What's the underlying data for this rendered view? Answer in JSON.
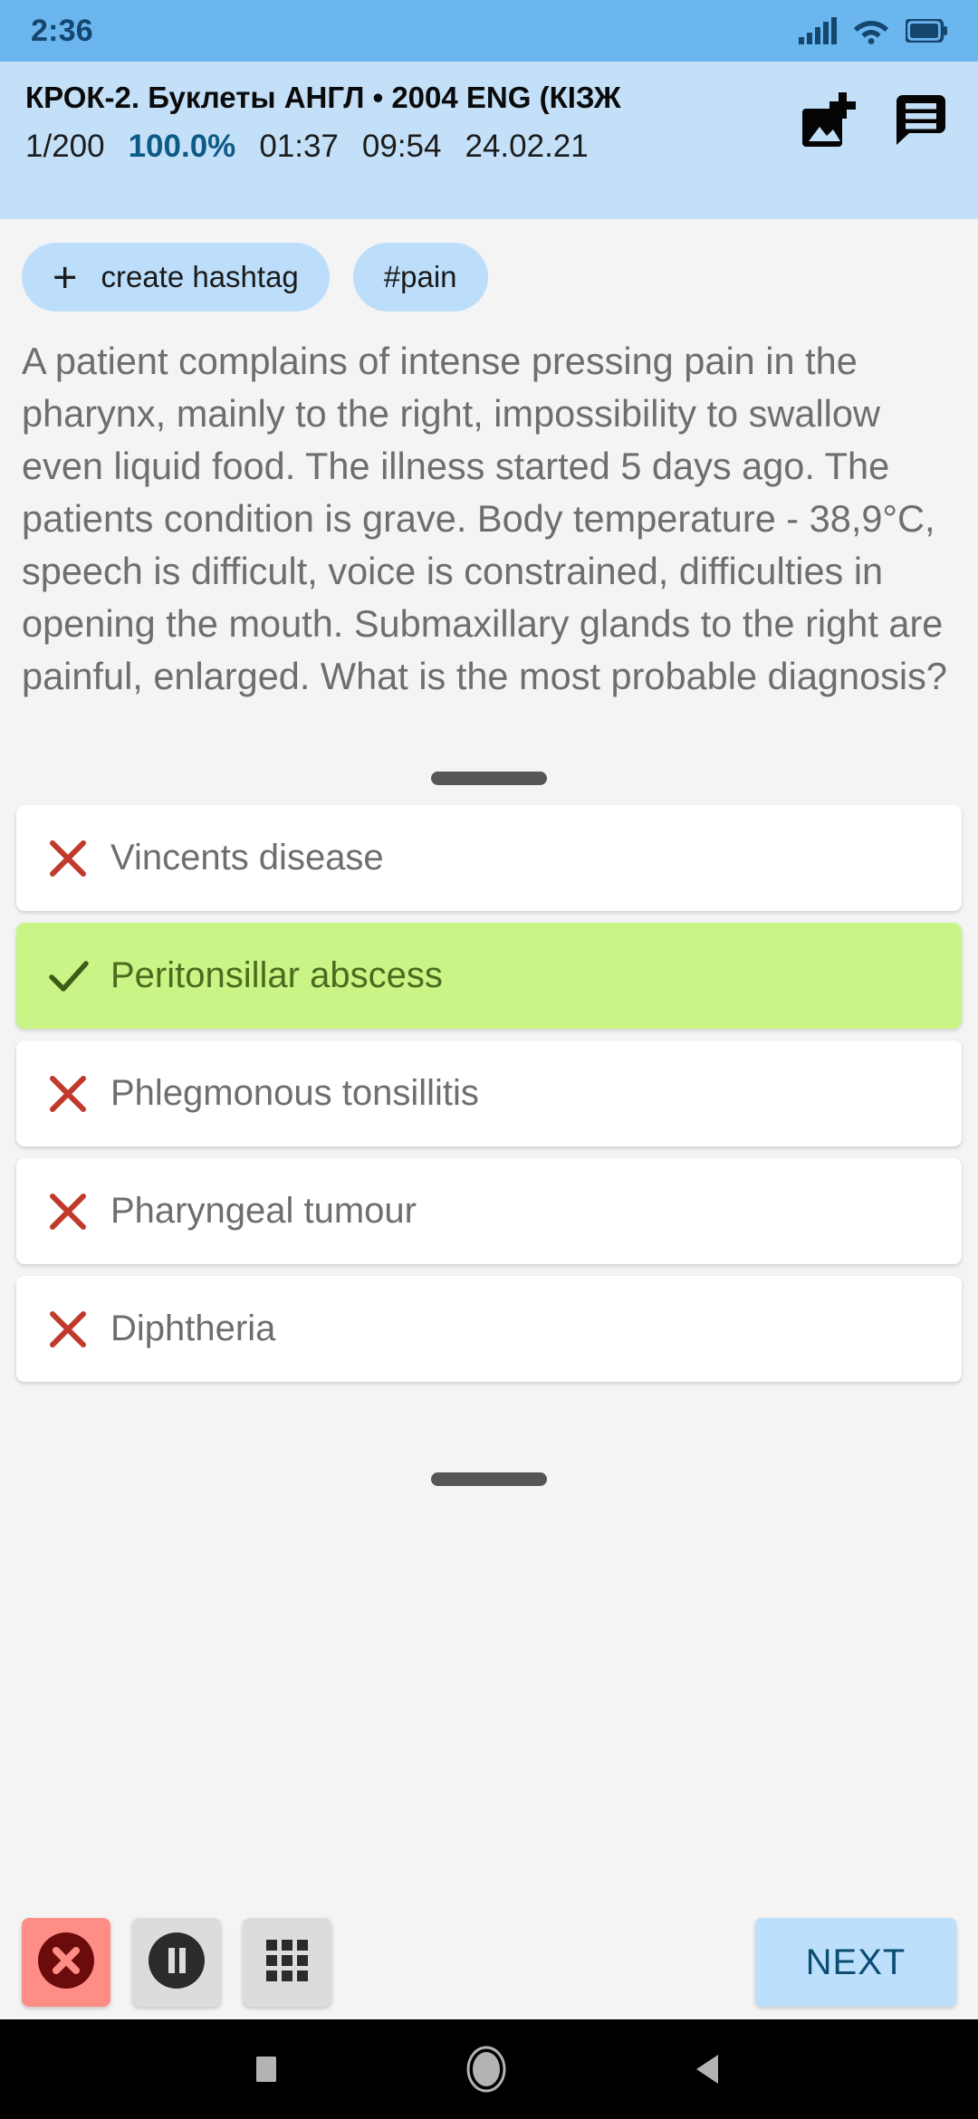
{
  "status_bar": {
    "time": "2:36",
    "icons": [
      "signal-icon",
      "wifi-icon",
      "battery-icon"
    ]
  },
  "header": {
    "title": "КРОК-2. Буклеты АНГЛ • 2004 ENG (КІЗЖ",
    "stats": {
      "progress": "1/200",
      "percent": "100.0%",
      "elapsed": "01:37",
      "total": "09:54",
      "date": "24.02.21"
    },
    "icons": [
      {
        "name": "add-image-icon"
      },
      {
        "name": "comment-icon"
      }
    ],
    "background_color": "#c3e0f8"
  },
  "hashtags": [
    {
      "label": "create hashtag",
      "has_plus": true
    },
    {
      "label": "#pain",
      "has_plus": false
    }
  ],
  "question": {
    "text": "A patient complains of intense pressing pain in the pharynx, mainly to the right, impossibility to swallow even liquid food. The illness started 5 days ago. The patients condition is grave. Body temperature - 38,9°C, speech is difficult, voice is constrained, difficulties in opening the mouth. Submaxillary glands to the right are painful, enlarged. What is the most probable diagnosis?"
  },
  "options": [
    {
      "label": "Vincents disease",
      "state": "incorrect",
      "mark": "cross-icon"
    },
    {
      "label": "Peritonsillar abscess",
      "state": "correct",
      "mark": "check-icon"
    },
    {
      "label": "Phlegmonous tonsillitis",
      "state": "incorrect",
      "mark": "cross-icon"
    },
    {
      "label": "Pharyngeal tumour",
      "state": "incorrect",
      "mark": "cross-icon"
    },
    {
      "label": "Diphtheria",
      "state": "incorrect",
      "mark": "cross-icon"
    }
  ],
  "toolbar": {
    "stop_label": "",
    "pause_label": "",
    "grid_label": "",
    "next_label": "NEXT"
  },
  "nav_bar": {
    "recents": "square-icon",
    "home": "circle-icon",
    "back": "triangle-back-icon"
  },
  "colors": {
    "accent": "#6cb6f0",
    "header_bg": "#c3e0f8",
    "correct_green": "#c8f585",
    "incorrect_red": "#c0392b",
    "stop_red": "#fd8d85",
    "next_blue": "#bcdffb",
    "page_bg": "#f4f4f4"
  }
}
